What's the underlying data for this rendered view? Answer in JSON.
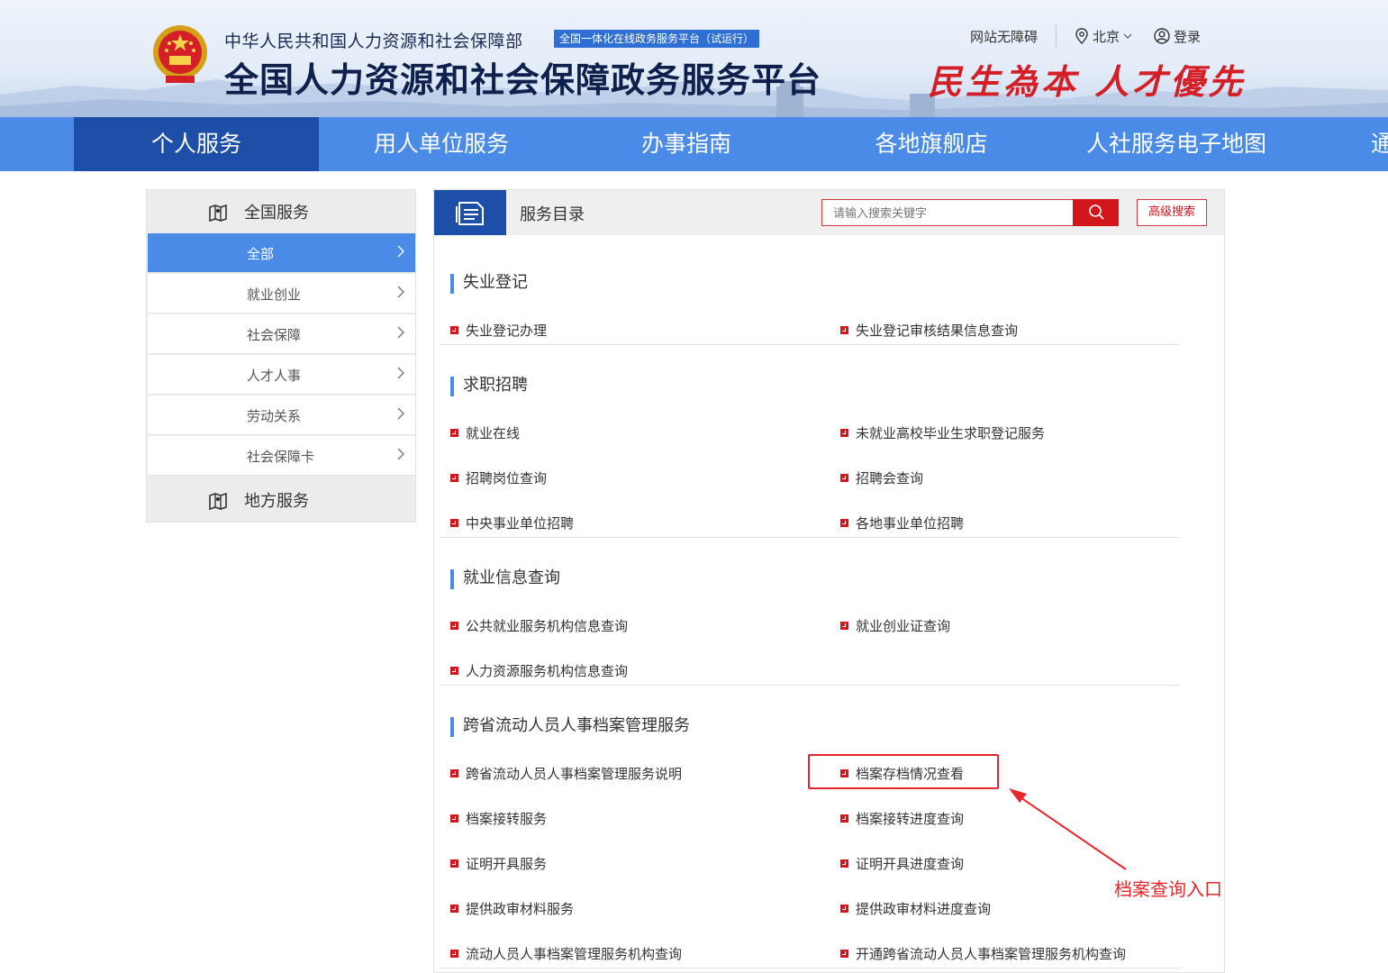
{
  "header": {
    "ministry_name": "中华人民共和国人力资源和社会保障部",
    "badge": "全国一体化在线政务服务平台（试运行）",
    "platform_name": "全国人力资源和社会保障政务服务平台",
    "slogan": "民生為本 人才優先",
    "accessibility_link": "网站无障碍",
    "location": "北京",
    "login": "登录"
  },
  "nav": {
    "items": [
      "个人服务",
      "用人单位服务",
      "办事指南",
      "各地旗舰店",
      "人社服务电子地图",
      "通"
    ],
    "active_index": 0
  },
  "sidebar": {
    "national_header": "全国服务",
    "items": [
      "全部",
      "就业创业",
      "社会保障",
      "人才人事",
      "劳动关系",
      "社会保障卡"
    ],
    "active_index": 0,
    "local_header": "地方服务"
  },
  "main": {
    "title": "服务目录",
    "search_placeholder": "请输入搜索关键字",
    "advanced_search": "高级搜索",
    "sections": [
      {
        "title": "失业登记",
        "links": [
          "失业登记办理",
          "失业登记审核结果信息查询"
        ]
      },
      {
        "title": "求职招聘",
        "links": [
          "就业在线",
          "未就业高校毕业生求职登记服务",
          "招聘岗位查询",
          "招聘会查询",
          "中央事业单位招聘",
          "各地事业单位招聘"
        ]
      },
      {
        "title": "就业信息查询",
        "links": [
          "公共就业服务机构信息查询",
          "就业创业证查询",
          "人力资源服务机构信息查询"
        ]
      },
      {
        "title": "跨省流动人员人事档案管理服务",
        "links": [
          "跨省流动人员人事档案管理服务说明",
          "档案存档情况查看",
          "档案接转服务",
          "档案接转进度查询",
          "证明开具服务",
          "证明开具进度查询",
          "提供政审材料服务",
          "提供政审材料进度查询",
          "流动人员人事档案管理服务机构查询",
          "开通跨省流动人员人事档案管理服务机构查询"
        ]
      }
    ]
  },
  "annotation": {
    "label": "档案查询入口",
    "color": "#e8262b"
  },
  "colors": {
    "nav_blue": "#4a8be8",
    "nav_active": "#1e4fa8",
    "accent_red": "#d3151c"
  }
}
